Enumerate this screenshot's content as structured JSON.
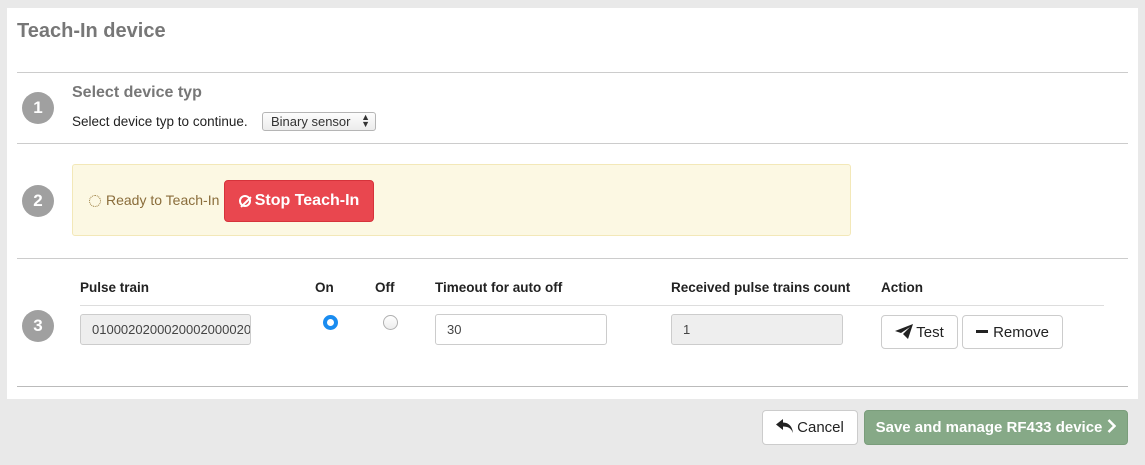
{
  "panel": {
    "title": "Teach-In device"
  },
  "steps": {
    "step1": {
      "number": "1",
      "title": "Select device typ",
      "prompt": "Select device typ to continue.",
      "device_type": {
        "selected": "Binary sensor"
      }
    },
    "step2": {
      "number": "2",
      "status_text": "Ready to Teach-In",
      "stop_button_label": "Stop Teach-In"
    },
    "step3": {
      "number": "3",
      "columns": {
        "pulse_train": "Pulse train",
        "on": "On",
        "off": "Off",
        "timeout": "Timeout for auto off",
        "received_count": "Received pulse trains count",
        "action": "Action"
      },
      "row": {
        "pulse_train": "0100020200020002000020",
        "on_selected": true,
        "off_selected": false,
        "timeout": "30",
        "received_count": "1",
        "test_label": "Test",
        "remove_label": "Remove"
      }
    }
  },
  "footer": {
    "cancel_label": "Cancel",
    "save_label": "Save and manage RF433 device"
  },
  "colors": {
    "danger": "#e9474f",
    "warning_bg": "#fcf8e3",
    "warning_text": "#8a6d3b",
    "radio_accent": "#1a8cf0",
    "save_disabled": "#86a987",
    "badge": "#a0a0a0"
  },
  "icons": {
    "spinner": "spinner-icon",
    "ban": "ban-icon",
    "plane": "paper-plane-icon",
    "minus": "minus-icon",
    "undo": "undo-icon",
    "chevron": "chevron-right-icon",
    "select_arrows": "select-arrows-icon"
  }
}
